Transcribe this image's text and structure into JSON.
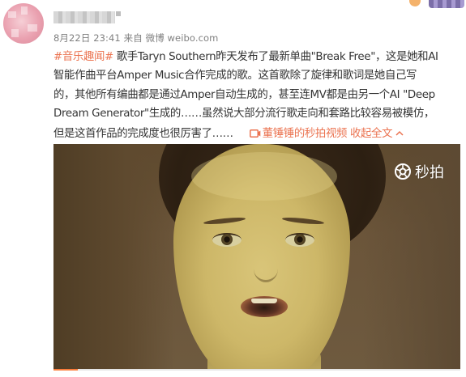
{
  "post": {
    "timestamp": "8月22日 23:41",
    "source_label": "来自",
    "source": "微博 weibo.com",
    "topic": "#音乐趣闻#",
    "lines": [
      " 歌手Taryn Southern昨天发布了最新单曲\"Break Free\"，这是她和AI",
      "智能作曲平台Amper Music合作完成的歌。这首歌除了旋律和歌词是她自己写",
      "的，其他所有编曲都是通过Amper自动生成的，甚至连MV都是由另一个AI \"Deep",
      "Dream Generator\"生成的……虽然说大部分流行歌走向和套路比较容易被模仿，",
      "但是这首作品的完成度也很厉害了……"
    ],
    "video_link": "董锤锤的秒拍视频",
    "collapse_label": "收起全文"
  },
  "video": {
    "watermark": "秒拍",
    "progress": 0.06
  },
  "icons": {
    "video_link_icon": "video-link-icon",
    "collapse_icon": "chevron-up-icon",
    "watermark_icon": "miaopai-logo-icon"
  },
  "colors": {
    "accent": "#eb7350",
    "body_text": "#333333",
    "meta_text": "#808080",
    "progress": "#fa7d3c"
  }
}
